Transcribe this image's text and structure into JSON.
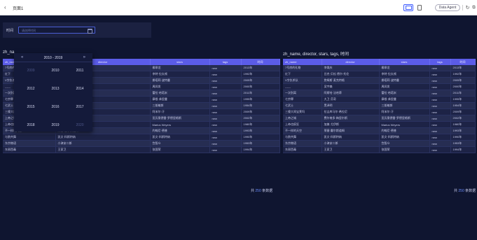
{
  "topbar": {
    "back_icon": "chevron-left-icon",
    "title": "页面1",
    "agent_label": "Data Agent",
    "buttons": [
      "desktop-icon",
      "mobile-icon",
      "refresh-icon",
      "external-link-icon"
    ]
  },
  "filter": {
    "label": "时间",
    "placeholder": "请选择时间"
  },
  "datepicker": {
    "prev": "«",
    "next": "»",
    "range": "2010 - 2019",
    "years": [
      "2009",
      "2010",
      "2011",
      "2012",
      "2013",
      "2014",
      "2015",
      "2016",
      "2017",
      "2018",
      "2019",
      "2020"
    ]
  },
  "left_panel": {
    "title": "zh_na"
  },
  "right_panel": {
    "title": "zh_name, director, stars, tags, 时间"
  },
  "table": {
    "headers": [
      "zh_name",
      "director",
      "stars",
      "tags",
      "时间"
    ],
    "rows": [
      [
        "7号房的礼物",
        "李焕庆",
        "柳承龙",
        "new",
        "2013年"
      ],
      [
        "红下",
        "吕克·贝松 德尔·托伦",
        "李特·拉丸顿",
        "new",
        "1992年"
      ],
      [
        "V字仇杀队",
        "詹姆斯·麦克特格",
        "娜塔莉·波特曼",
        "new",
        "2005年"
      ],
      [
        "------",
        "吴宇森",
        "周润发",
        "new",
        "2000年"
      ],
      [
        "一次别离",
        "阿斯哈·法哈蒂",
        "蕾拉·哈塔米",
        "new",
        "2011年"
      ],
      [
        "七宗罪",
        "大卫·芬奇",
        "摩根·弗里曼",
        "new",
        "1995年"
      ],
      [
        "七武士",
        "黑泽明",
        "三船敏郎",
        "new",
        "1954年"
      ],
      [
        "三傻大闹宝莱坞",
        "拉吉库马尔·希拉尼",
        "阿米尔·汗",
        "new",
        "2009年"
      ],
      [
        "上帝之城",
        "费尔南多·梅里尔斯",
        "亚历桑德雷·罗德里格斯",
        "new",
        "2002年"
      ],
      [
        "上帝也疯狂",
        "加美·尤伊斯",
        "Marius Weyers",
        "new",
        "1980年"
      ],
      [
        "不一样的天空",
        "莱塞·霍尔斯道姆",
        "约翰尼·德普",
        "new",
        "1993年"
      ],
      [
        "与狼共舞",
        "凯文·科斯特纳",
        "凯文·科斯特纳",
        "new",
        "1990年"
      ],
      [
        "东京物语",
        "小津安二郎",
        "笠智众",
        "new",
        "1953年"
      ],
      [
        "东邪西毒",
        "王家卫",
        "张国荣",
        "new",
        "1994年"
      ]
    ]
  },
  "pager": {
    "prefix": "共 ",
    "count": "250",
    "suffix": " 条数据"
  },
  "colors": {
    "accent": "#5b5ce8",
    "canvas": "#0f1530",
    "link": "#6a8cff"
  }
}
